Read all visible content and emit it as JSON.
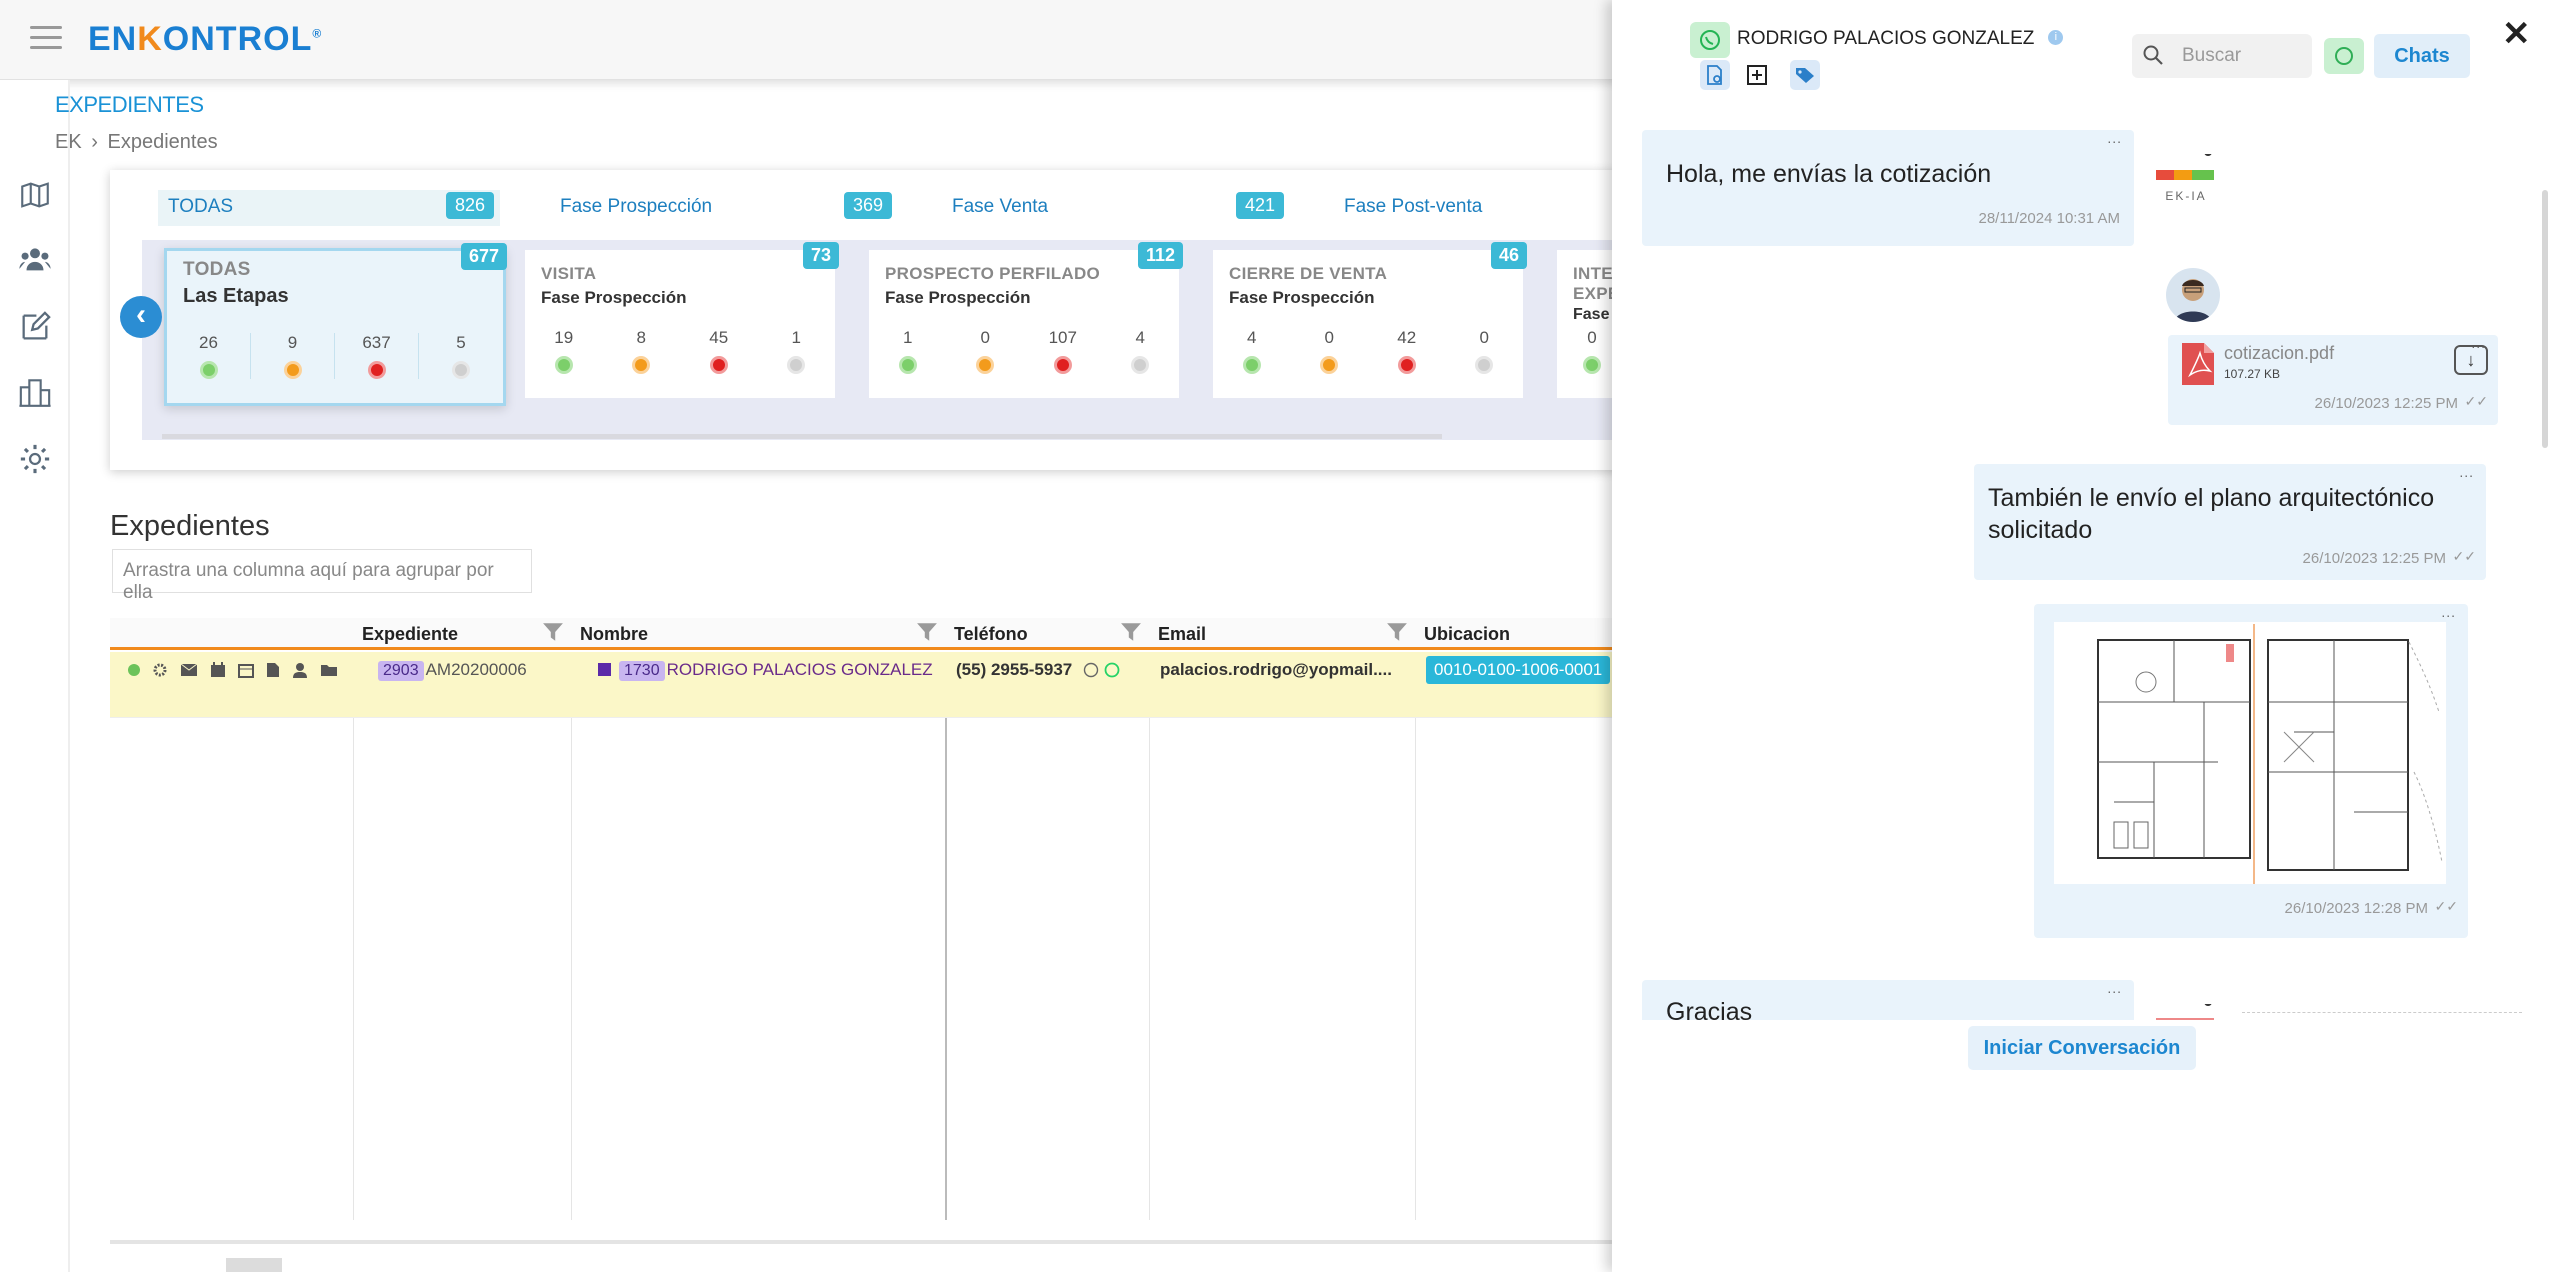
{
  "app": {
    "logo": "ENKONTROL",
    "logo_mark": "®"
  },
  "breadcrumb": {
    "section": "EXPEDIENTES",
    "root": "EK",
    "current": "Expedientes"
  },
  "phase_tabs": [
    {
      "label": "TODAS",
      "count": "826"
    },
    {
      "label": "Fase Prospección",
      "count": "369"
    },
    {
      "label": "Fase Venta",
      "count": "421"
    },
    {
      "label": "Fase Post-venta",
      "count": ""
    }
  ],
  "stages": [
    {
      "title": "TODAS",
      "subtitle": "Las Etapas",
      "count": "677",
      "nums": [
        "26",
        "9",
        "637",
        "5"
      ]
    },
    {
      "title": "VISITA",
      "subtitle": "Fase Prospección",
      "count": "73",
      "nums": [
        "19",
        "8",
        "45",
        "1"
      ]
    },
    {
      "title": "PROSPECTO PERFILADO",
      "subtitle": "Fase Prospección",
      "count": "112",
      "nums": [
        "1",
        "0",
        "107",
        "4"
      ]
    },
    {
      "title": "CIERRE DE VENTA",
      "subtitle": "Fase Prospección",
      "count": "46",
      "nums": [
        "4",
        "0",
        "42",
        "0"
      ]
    },
    {
      "title": "INTE",
      "title2": "EXPE",
      "subtitle": "Fase",
      "count": "",
      "nums": [
        "0"
      ]
    }
  ],
  "grid": {
    "title": "Expedientes",
    "group_placeholder": "Arrastra una columna aquí para agrupar por ella",
    "columns": [
      "Expediente",
      "Nombre",
      "Teléfono",
      "Email",
      "Ubicacion"
    ],
    "row": {
      "exp_tag": "2903",
      "exp_code": "AM20200006",
      "name_tag": "1730",
      "name": "RODRIGO PALACIOS GONZALEZ",
      "phone": "(55) 2955-5937",
      "email": "palacios.rodrigo@yopmail....",
      "ubicacion": "0010-0100-1006-0001"
    }
  },
  "chat": {
    "contact": "RODRIGO PALACIOS GONZALEZ",
    "search_placeholder": "Buscar",
    "chats_label": "Chats",
    "start_label": "Iniciar Conversación",
    "ekia_label": "EK-IA",
    "messages": [
      {
        "text": "Hola, me envías la cotización",
        "time": "28/11/2024 10:31 AM"
      },
      {
        "file": "cotizacion.pdf",
        "size": "107.27 KB",
        "time": "26/10/2023 12:25 PM"
      },
      {
        "text": "También le envío el plano arquitectónico solicitado",
        "time": "26/10/2023 12:25 PM"
      },
      {
        "image": "floor-plan",
        "time": "26/10/2023 12:28 PM"
      },
      {
        "text": "Gracias"
      }
    ]
  },
  "colors": {
    "brand": "#1a7fd2",
    "accent": "#f18a1c",
    "badge": "#3cb9d6",
    "whatsapp": "#25d366"
  }
}
